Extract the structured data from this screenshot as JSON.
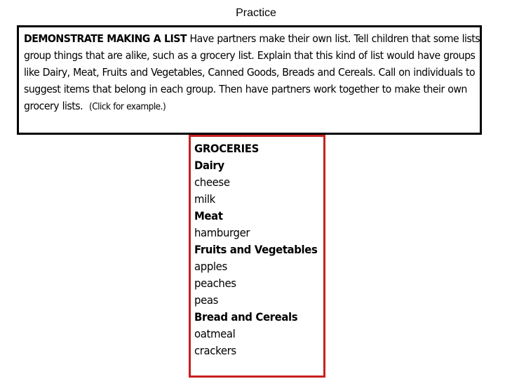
{
  "title": "Practice",
  "instructions": {
    "heading": "DEMONSTRATE MAKING A LIST",
    "body": "Have partners make their own list. Tell children that some lists group things that are alike, such as a grocery list. Explain that this kind of list would have groups like Dairy, Meat, Fruits and Vegetables, Canned Goods, Breads and Cereals. Call on individuals to suggest items that belong in each group. Then have partners work together to make their own grocery lists.",
    "click_note": "(Click for example.)"
  },
  "grocery_list": {
    "title": "GROCERIES",
    "accent_color": "#c8201f",
    "items": [
      {
        "text": "Dairy",
        "type": "category"
      },
      {
        "text": "cheese",
        "type": "item"
      },
      {
        "text": "milk",
        "type": "item"
      },
      {
        "text": "Meat",
        "type": "category"
      },
      {
        "text": "hamburger",
        "type": "item"
      },
      {
        "text": "Fruits and Vegetables",
        "type": "category"
      },
      {
        "text": "apples",
        "type": "item"
      },
      {
        "text": "peaches",
        "type": "item"
      },
      {
        "text": "peas",
        "type": "item"
      },
      {
        "text": "Bread and Cereals",
        "type": "category"
      },
      {
        "text": "oatmeal",
        "type": "item"
      },
      {
        "text": "crackers",
        "type": "item"
      }
    ]
  }
}
